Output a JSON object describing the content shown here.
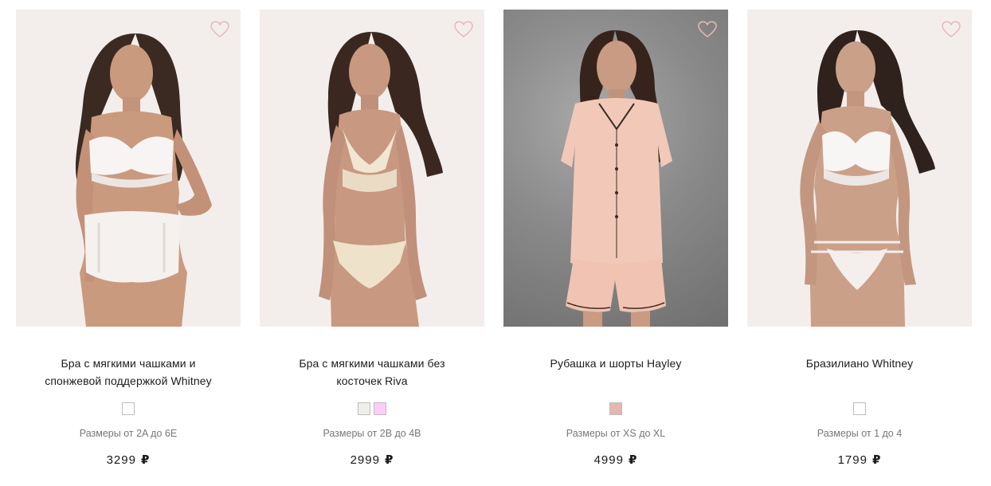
{
  "colors": {
    "heart_outline": "#e8b9b9",
    "photo_bg_light": "#f3eeec",
    "photo_bg_grey": "#8a8a8a"
  },
  "products": [
    {
      "title_line1": "Бра с мягкими чашками и",
      "title_line2": "спонжевой поддержкой Whitney",
      "swatches": [
        "#ffffff"
      ],
      "sizes": "Размеры от 2A до 6E",
      "price": "3299",
      "currency": "₽",
      "outfit": "white-lace-set",
      "wishlist_icon": "heart-outline-icon"
    },
    {
      "title_line1": "Бра с мягкими чашками без",
      "title_line2": "косточек Riva",
      "swatches": [
        "#eeeeea",
        "#fccdf6"
      ],
      "sizes": "Размеры от 2B до 4B",
      "price": "2999",
      "currency": "₽",
      "outfit": "cream-lace-set",
      "wishlist_icon": "heart-outline-icon"
    },
    {
      "title_line1": "Рубашка и шорты Hayley",
      "title_line2": "",
      "swatches": [
        "#e8b5b2"
      ],
      "sizes": "Размеры от XS до XL",
      "price": "4999",
      "currency": "₽",
      "outfit": "peach-satin-pajama",
      "wishlist_icon": "heart-outline-icon"
    },
    {
      "title_line1": "Бразилиано Whitney",
      "title_line2": "",
      "swatches": [
        "#ffffff"
      ],
      "sizes": "Размеры от 1 до 4",
      "price": "1799",
      "currency": "₽",
      "outfit": "white-lace-bra-brazilian",
      "wishlist_icon": "heart-outline-icon"
    }
  ]
}
